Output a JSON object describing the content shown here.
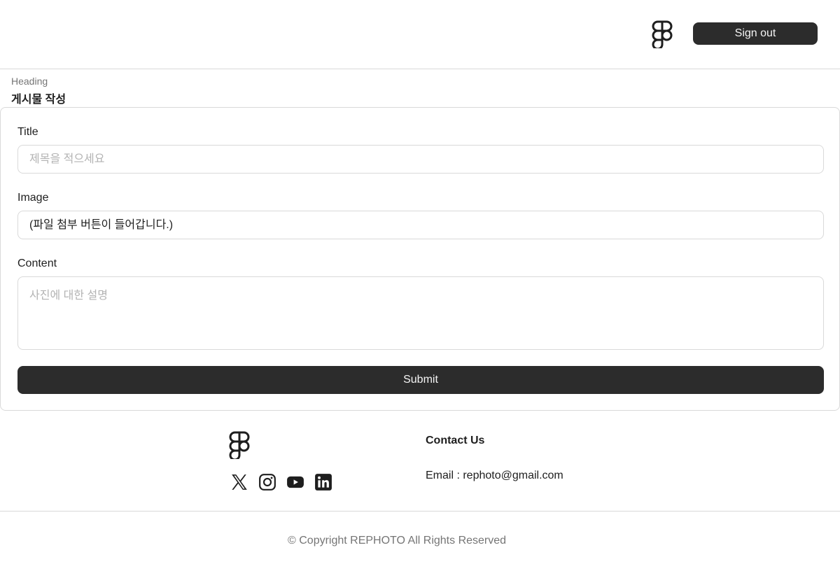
{
  "header": {
    "logo_icon": "figma-logo-icon",
    "signout_label": "Sign out"
  },
  "page_heading": {
    "caption": "Heading",
    "title": "게시물 작성"
  },
  "form": {
    "title_label": "Title",
    "title_placeholder": "제목을 적으세요",
    "title_value": "",
    "image_label": "Image",
    "image_value": "(파일 첨부 버튼이 들어갑니다.)",
    "content_label": "Content",
    "content_placeholder": "사진에 대한 설명",
    "content_value": "",
    "submit_label": "Submit"
  },
  "footer": {
    "logo_icon": "figma-logo-icon",
    "social_icons": [
      "x-twitter-icon",
      "instagram-icon",
      "youtube-icon",
      "linkedin-icon"
    ],
    "contact_title": "Contact Us",
    "contact_email": "Email : rephoto@gmail.com",
    "copyright": "© Copyright REPHOTO All Rights Reserved"
  },
  "colors": {
    "primary_button": "#2c2c2c",
    "button_text": "#f5f5f5",
    "border": "#d9d9d9",
    "secondary_text": "#757575",
    "placeholder": "#b3b3b3"
  }
}
